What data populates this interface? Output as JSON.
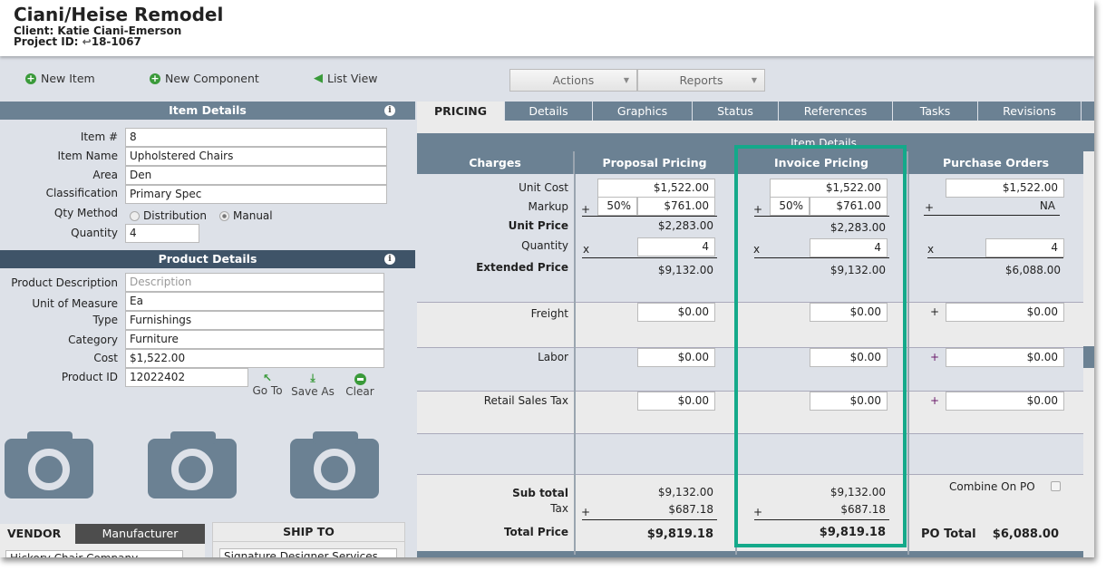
{
  "header": {
    "title": "Ciani/Heise Remodel",
    "client": "Client: Katie Ciani-Emerson",
    "project_id_label": "Project ID:",
    "project_id": "18-1067"
  },
  "toolbar": {
    "new_item": "New Item",
    "new_component": "New Component",
    "list_view": "List View",
    "actions": "Actions",
    "reports": "Reports"
  },
  "item_details": {
    "title": "Item Details",
    "fields": [
      {
        "label": "Item #",
        "value": "8"
      },
      {
        "label": "Item Name",
        "value": "Upholstered Chairs"
      },
      {
        "label": "Area",
        "value": "Den"
      },
      {
        "label": "Classification",
        "value": "Primary Spec"
      }
    ],
    "qty_method_label": "Qty Method",
    "qty_options": [
      "Distribution",
      "Manual"
    ],
    "qty_selected": "Manual",
    "quantity_label": "Quantity",
    "quantity": "4"
  },
  "product_details": {
    "title": "Product Details",
    "description_label": "Product Description",
    "description_placeholder": "Description",
    "fields": [
      {
        "label": "Unit of Measure",
        "value": "Ea"
      },
      {
        "label": "Type",
        "value": "Furnishings"
      },
      {
        "label": "Category",
        "value": "Furniture"
      },
      {
        "label": "Cost",
        "value": "$1,522.00"
      }
    ],
    "product_id_label": "Product ID",
    "product_id": "12022402",
    "actions": [
      "Go To",
      "Save As",
      "Clear"
    ]
  },
  "vendor": {
    "tab": "VENDOR",
    "tab2": "Manufacturer",
    "value": "Hickory Chair Company"
  },
  "ship_to": {
    "title": "SHIP TO",
    "value": "Signature Designer Services"
  },
  "tabs": [
    "PRICING",
    "Details",
    "Graphics",
    "Status",
    "References",
    "Tasks",
    "Revisions"
  ],
  "active_tab": "PRICING",
  "pricing": {
    "section_title": "Item Details",
    "columns": [
      "Charges",
      "Proposal Pricing",
      "Invoice Pricing",
      "Purchase Orders"
    ],
    "labels": {
      "unit_cost": "Unit Cost",
      "markup": "Markup",
      "unit_price": "Unit Price",
      "quantity": "Quantity",
      "extended_price": "Extended Price",
      "freight": "Freight",
      "labor": "Labor",
      "retail_sales_tax": "Retail Sales Tax",
      "sub_total": "Sub total",
      "tax": "Tax",
      "total_price": "Total Price"
    },
    "proposal": {
      "unit_cost": "$1,522.00",
      "markup_pct": "50%",
      "markup": "$761.00",
      "unit_price": "$2,283.00",
      "quantity": "4",
      "extended_price": "$9,132.00",
      "freight": "$0.00",
      "labor": "$0.00",
      "retail_sales_tax": "$0.00",
      "sub_total": "$9,132.00",
      "tax": "$687.18",
      "total_price": "$9,819.18"
    },
    "invoice": {
      "unit_cost": "$1,522.00",
      "markup_pct": "50%",
      "markup": "$761.00",
      "unit_price": "$2,283.00",
      "quantity": "4",
      "extended_price": "$9,132.00",
      "freight": "$0.00",
      "labor": "$0.00",
      "retail_sales_tax": "$0.00",
      "sub_total": "$9,132.00",
      "tax": "$687.18",
      "total_price": "$9,819.18"
    },
    "purchase_orders": {
      "unit_cost": "$1,522.00",
      "markup": "NA",
      "quantity": "4",
      "extended_price": "$6,088.00",
      "freight": "$0.00",
      "labor": "$0.00",
      "retail_sales_tax": "$0.00",
      "combine_label": "Combine On PO",
      "combine_checked": false,
      "po_total_label": "PO Total",
      "po_total": "$6,088.00"
    },
    "ops": {
      "plus": "+",
      "times": "x"
    }
  },
  "colors": {
    "highlight": "#14a98a",
    "bar": "#6b8193",
    "bar_dark": "#3f5468",
    "icon_green": "#3a9a3a"
  }
}
